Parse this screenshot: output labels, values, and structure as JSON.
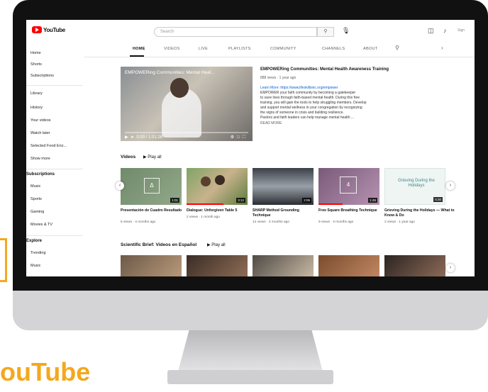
{
  "masthead": {
    "logo_text": "YouTube",
    "search_placeholder": "Search",
    "search_icon": "search-icon",
    "mic_icon": "mic-icon",
    "create_icon": "video-create-icon",
    "bell_icon": "bell-icon",
    "account_text": "Sign"
  },
  "sidebar": {
    "items_top": [
      "Home",
      "Shorts",
      "Subscriptions"
    ],
    "items_library": [
      "Library",
      "History",
      "Your videos",
      "Watch later",
      "Selected Food Enz...",
      "Show more"
    ],
    "subscriptions_label": "Subscriptions",
    "subscriptions": [
      "Music",
      "Sports",
      "Gaming",
      "Movies & TV"
    ],
    "explore_label": "Explore",
    "explore": [
      "Trending",
      "Music"
    ]
  },
  "tabs": [
    "HOME",
    "VIDEOS",
    "LIVE",
    "PLAYLISTS",
    "COMMUNITY",
    "CHANNELS",
    "ABOUT"
  ],
  "featured": {
    "overlay_title": "EMPOWERing Communities: Mental Heal...",
    "info_title": "EMPOWERing Communities: Mental Health Awareness Training",
    "meta": "888 views · 1 year ago",
    "desc_lines": [
      "Learn More: https://www.lifeskillsinc.org/empower",
      "EMPOWER your faith community by becoming a gatekeeper",
      "to save lives through faith-based mental health. During this free",
      "training, you will gain the tools to help struggling members. Develop",
      "and support mental wellness in your congregation by recognizing",
      "the signs of someone in crisis and building resilience.",
      "Pastors and faith leaders can help manage mental health ..."
    ],
    "more": "READ MORE",
    "time": "0:00 / 1:01:26"
  },
  "shelf1": {
    "title": "Videos",
    "play_all": "Play all",
    "videos": [
      {
        "title": "Presentación de Cuadro Resultado",
        "meta": "5 views · 4 months ago",
        "duration": "1:01",
        "overlay": "Δ"
      },
      {
        "title": "Dialogue: Unforgiven Table 5",
        "meta": "2 views · 1 month ago",
        "duration": "3:12",
        "overlay": ""
      },
      {
        "title": "SHARP Method Grounding Technique",
        "meta": "14 views · 2 months ago",
        "duration": "2:05",
        "overlay": ""
      },
      {
        "title": "Free Square Breathing Technique",
        "meta": "9 views · 3 months ago",
        "duration": "1:45",
        "overlay": "4"
      },
      {
        "title": "Grieving During the Holidays — What to Know & Do",
        "meta": "2 views · 1 year ago",
        "duration": "5:30",
        "overlay": "Grieving During the Holidays"
      }
    ]
  },
  "shelf2": {
    "title": "Scientific Brief: Videos en Español",
    "play_all": "Play all"
  }
}
